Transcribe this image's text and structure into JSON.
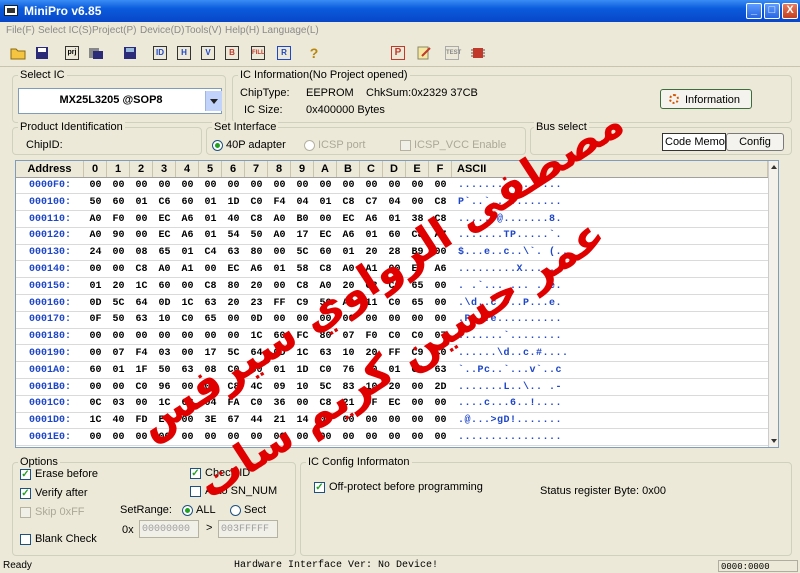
{
  "window": {
    "title": "MiniPro v6.85",
    "minimize": "_",
    "maximize": "□",
    "close": "X"
  },
  "menu": [
    "File(F)",
    "Select IC(S)",
    "Project(P)",
    "Device(D)",
    "Tools(V)",
    "Help(H)",
    "Language(L)"
  ],
  "toolbar": {
    "icons": [
      "open-folder-icon",
      "save-icon",
      "save-project-icon",
      "load-project-icon",
      "save-buffer-icon",
      "ic-info-icon",
      "id-icon",
      "verify-icon",
      "blank-check-icon",
      "fill-icon",
      "read-icon",
      "help-icon",
      "program-icon",
      "edit-icon",
      "test-icon",
      "chip-icon"
    ]
  },
  "select_ic": {
    "label": "Select IC",
    "value": "MX25L3205  @SOP8"
  },
  "ic_info": {
    "label": "IC Information(No Project opened)",
    "chiptype_label": "ChipType:",
    "chiptype_value": "EEPROM",
    "chksum": "ChkSum:0x2329 37CB",
    "icsize_label": "IC Size:",
    "icsize_value": "0x400000 Bytes",
    "info_button": "Information"
  },
  "product_id": {
    "label": "Product Identification",
    "chipid_label": "ChipID:"
  },
  "interface": {
    "label": "Set Interface",
    "opt1": "40P adapter",
    "opt2": "ICSP port",
    "opt3": "ICSP_VCC Enable"
  },
  "bus": {
    "label": "Bus select",
    "code_memo": "Code Memo",
    "config": "Config"
  },
  "hex": {
    "header_address": "Address",
    "columns": [
      "0",
      "1",
      "2",
      "3",
      "4",
      "5",
      "6",
      "7",
      "8",
      "9",
      "A",
      "B",
      "C",
      "D",
      "E",
      "F"
    ],
    "header_ascii": "ASCII",
    "rows": [
      {
        "addr": "0000F0:",
        "bytes": [
          "00",
          "00",
          "00",
          "00",
          "00",
          "00",
          "00",
          "00",
          "00",
          "00",
          "00",
          "00",
          "00",
          "00",
          "00",
          "00"
        ],
        "ascii": "................"
      },
      {
        "addr": "000100:",
        "bytes": [
          "50",
          "60",
          "01",
          "C6",
          "60",
          "01",
          "1D",
          "C0",
          "F4",
          "04",
          "01",
          "C8",
          "C7",
          "04",
          "00",
          "C8"
        ],
        "ascii": "P`..`..........."
      },
      {
        "addr": "000110:",
        "bytes": [
          "A0",
          "F0",
          "00",
          "EC",
          "A6",
          "01",
          "40",
          "C8",
          "A0",
          "B0",
          "00",
          "EC",
          "A6",
          "01",
          "38",
          "C8"
        ],
        "ascii": "......@.......8."
      },
      {
        "addr": "000120:",
        "bytes": [
          "A0",
          "90",
          "00",
          "EC",
          "A6",
          "01",
          "54",
          "50",
          "A0",
          "17",
          "EC",
          "A6",
          "01",
          "60",
          "C8",
          "A7"
        ],
        "ascii": ".......TP.....`."
      },
      {
        "addr": "000130:",
        "bytes": [
          "24",
          "00",
          "08",
          "65",
          "01",
          "C4",
          "63",
          "80",
          "00",
          "5C",
          "60",
          "01",
          "20",
          "28",
          "B9",
          "00"
        ],
        "ascii": "$...e..c..\\`. (.."
      },
      {
        "addr": "000140:",
        "bytes": [
          "00",
          "00",
          "C8",
          "A0",
          "A1",
          "00",
          "EC",
          "A6",
          "01",
          "58",
          "C8",
          "A0",
          "A1",
          "00",
          "EC",
          "A6"
        ],
        "ascii": ".........X......"
      },
      {
        "addr": "000150:",
        "bytes": [
          "01",
          "20",
          "1C",
          "60",
          "00",
          "C8",
          "80",
          "20",
          "00",
          "C8",
          "A0",
          "20",
          "C2",
          "C0",
          "65",
          "00"
        ],
        "ascii": ". .`... ... ..e."
      },
      {
        "addr": "000160:",
        "bytes": [
          "0D",
          "5C",
          "64",
          "0D",
          "1C",
          "63",
          "20",
          "23",
          "FF",
          "C9",
          "50",
          "A0",
          "11",
          "C0",
          "65",
          "00"
        ],
        "ascii": ".\\d..c #..P...e."
      },
      {
        "addr": "000170:",
        "bytes": [
          "0F",
          "50",
          "63",
          "10",
          "C0",
          "65",
          "00",
          "0D",
          "00",
          "00",
          "00",
          "00",
          "00",
          "00",
          "00",
          "00"
        ],
        "ascii": ".Pc..e.........."
      },
      {
        "addr": "000180:",
        "bytes": [
          "00",
          "00",
          "00",
          "00",
          "00",
          "00",
          "00",
          "1C",
          "60",
          "FC",
          "80",
          "07",
          "F0",
          "C0",
          "C0",
          "07"
        ],
        "ascii": ".......`........"
      },
      {
        "addr": "000190:",
        "bytes": [
          "00",
          "07",
          "F4",
          "03",
          "00",
          "17",
          "5C",
          "64",
          "0D",
          "1C",
          "63",
          "10",
          "20",
          "FF",
          "C9",
          "C0"
        ],
        "ascii": "......\\d..c.#...."
      },
      {
        "addr": "0001A0:",
        "bytes": [
          "60",
          "01",
          "1F",
          "50",
          "63",
          "08",
          "C0",
          "60",
          "01",
          "1D",
          "C0",
          "76",
          "60",
          "01",
          "C8",
          "63"
        ],
        "ascii": "`..Pc..`...v`..c"
      },
      {
        "addr": "0001B0:",
        "bytes": [
          "00",
          "00",
          "C0",
          "96",
          "00",
          "01",
          "C8",
          "4C",
          "09",
          "10",
          "5C",
          "83",
          "10",
          "20",
          "00",
          "2D"
        ],
        "ascii": ".......L..\\.. .-"
      },
      {
        "addr": "0001C0:",
        "bytes": [
          "0C",
          "03",
          "00",
          "1C",
          "63",
          "04",
          "FA",
          "C0",
          "36",
          "00",
          "C8",
          "21",
          "0F",
          "EC",
          "00",
          "00"
        ],
        "ascii": "....c...6..!...."
      },
      {
        "addr": "0001D0:",
        "bytes": [
          "1C",
          "40",
          "FD",
          "E4",
          "00",
          "3E",
          "67",
          "44",
          "21",
          "14",
          "00",
          "00",
          "00",
          "00",
          "00",
          "00"
        ],
        "ascii": ".@...>gD!......."
      },
      {
        "addr": "0001E0:",
        "bytes": [
          "00",
          "00",
          "00",
          "00",
          "00",
          "00",
          "00",
          "00",
          "00",
          "00",
          "00",
          "00",
          "00",
          "00",
          "00",
          "00"
        ],
        "ascii": "................"
      }
    ]
  },
  "options": {
    "label": "Options",
    "erase": "Erase before",
    "verify": "Verify after",
    "skip": "Skip 0xFF",
    "blank": "Blank Check",
    "check_id": "Check ID",
    "auto_sn": "Auto SN_NUM",
    "setrange": "SetRange:",
    "all": "ALL",
    "sect": "Sect",
    "ox": "0x",
    "range_start": "00000000",
    "range_sep": ">",
    "range_end": "003FFFFF"
  },
  "ic_config": {
    "label": "IC Config Informaton",
    "off_protect": "Off-protect before programming",
    "status_reg": "Status register Byte: 0x00"
  },
  "status": {
    "ready": "Ready",
    "hw": "Hardware Interface Ver: No Device!",
    "addr": "0000:0000"
  },
  "watermark": {
    "line1": "مصطفى الرواوي سيرفس",
    "line2": "عمر حسين كريم سات",
    "color": "#E00000"
  }
}
